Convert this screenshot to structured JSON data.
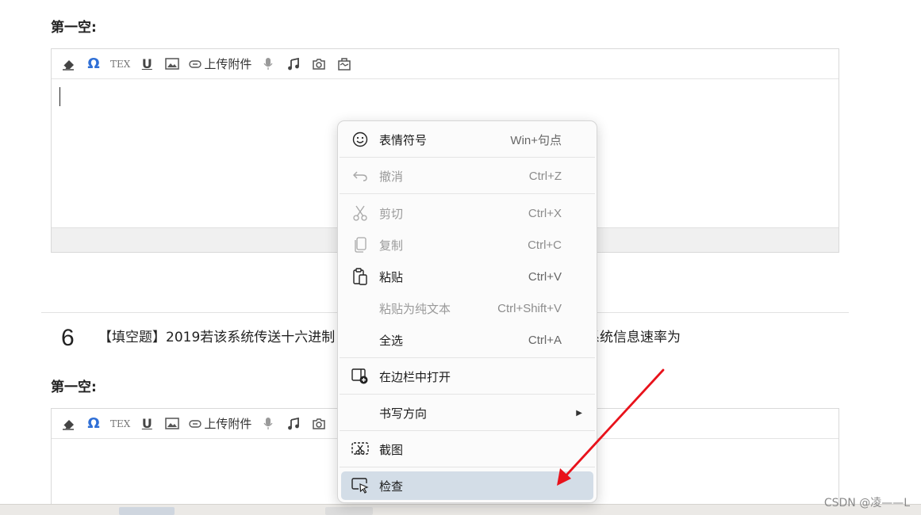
{
  "question5": {
    "blank_label": "第一空:"
  },
  "toolbar": {
    "eraser_icon": "eraser-icon",
    "omega_label": "Ω",
    "tex_label": "TEX",
    "underline_label": "U",
    "upload_label": "上传附件"
  },
  "question6": {
    "number": "6",
    "text_left": "【填空题】2019若该系统传送十六进制",
    "text_right": "系统信息速率为",
    "blank_label": "第一空:"
  },
  "context_menu": {
    "items": [
      {
        "label": "表情符号",
        "shortcut": "Win+句点",
        "icon": "emoji-icon",
        "disabled": false
      },
      {
        "label": "撤消",
        "shortcut": "Ctrl+Z",
        "icon": "undo-icon",
        "disabled": true
      },
      {
        "label": "剪切",
        "shortcut": "Ctrl+X",
        "icon": "cut-icon",
        "disabled": true
      },
      {
        "label": "复制",
        "shortcut": "Ctrl+C",
        "icon": "copy-icon",
        "disabled": true
      },
      {
        "label": "粘贴",
        "shortcut": "Ctrl+V",
        "icon": "paste-icon",
        "disabled": false
      },
      {
        "label": "粘贴为纯文本",
        "shortcut": "Ctrl+Shift+V",
        "icon": "",
        "disabled": true
      },
      {
        "label": "全选",
        "shortcut": "Ctrl+A",
        "icon": "",
        "disabled": false
      },
      {
        "label": "在边栏中打开",
        "shortcut": "",
        "icon": "sidebar-open-icon",
        "disabled": false
      },
      {
        "label": "书写方向",
        "shortcut": "",
        "icon": "",
        "disabled": false
      },
      {
        "label": "截图",
        "shortcut": "",
        "icon": "screenshot-icon",
        "disabled": false
      },
      {
        "label": "检查",
        "shortcut": "",
        "icon": "inspect-icon",
        "disabled": false
      }
    ]
  },
  "watermark": "CSDN @凌——L",
  "colors": {
    "accent_blue": "#2f6fd6",
    "arrow_red": "#e8121b",
    "highlight": "#d3dde7"
  }
}
